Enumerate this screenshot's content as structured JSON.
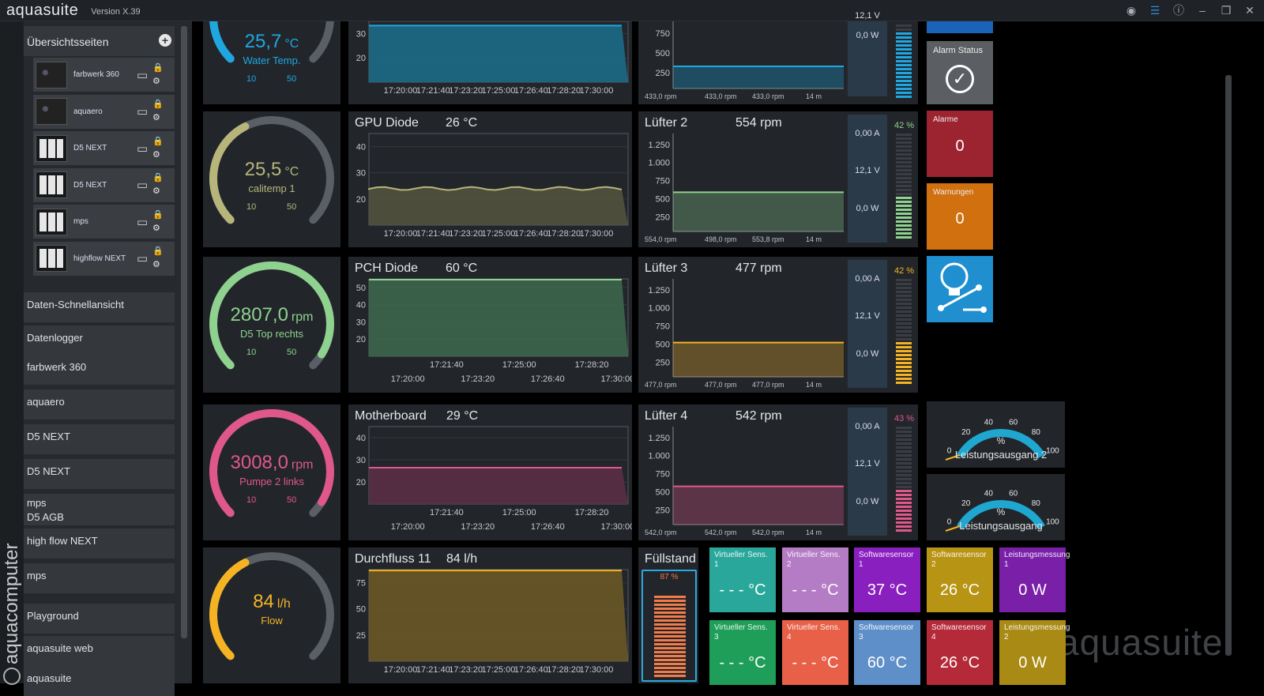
{
  "window": {
    "app_name": "aquasuite",
    "version": "Version X.39"
  },
  "sidebar": {
    "section_overview": "Übersichtsseiten",
    "overview_items": [
      {
        "label": "farbwerk 360",
        "thumb": "device"
      },
      {
        "label": "aquaero",
        "thumb": "device"
      },
      {
        "label": "D5 NEXT",
        "thumb": "grid"
      },
      {
        "label": "D5 NEXT",
        "thumb": "grid"
      },
      {
        "label": "mps",
        "thumb": "grid"
      },
      {
        "label": "highflow NEXT",
        "thumb": "grid"
      }
    ],
    "sections": [
      "Daten-Schnellansicht",
      "Datenlogger",
      "farbwerk 360",
      "aquaero",
      "D5 NEXT",
      "D5 NEXT",
      "mps",
      "D5 AGB",
      "high flow NEXT",
      "mps",
      "Playground",
      "aquasuite web",
      "aquasuite"
    ],
    "brand_vertical": "aquacomputer"
  },
  "gauges": [
    {
      "value": "25,7",
      "unit": "°C",
      "label": "Water Temp.",
      "min": "10",
      "max": "50",
      "color": "#1fa7e0",
      "fill": 0.42
    },
    {
      "value": "25,5",
      "unit": "°C",
      "label": "calitemp 1",
      "min": "10",
      "max": "50",
      "color": "#b7b57a",
      "fill": 0.4
    },
    {
      "value": "2807,0",
      "unit": "rpm",
      "label": "D5  Top rechts",
      "min": "10",
      "max": "50",
      "color": "#8fd18e",
      "fill": 0.95
    },
    {
      "value": "3008,0",
      "unit": "rpm",
      "label": "Pumpe 2 links",
      "min": "10",
      "max": "50",
      "color": "#e0578a",
      "fill": 0.95
    },
    {
      "value": "84",
      "unit": "l/h",
      "label": "Flow",
      "min": "",
      "max": "",
      "color": "#f5b324",
      "fill": 0.4
    }
  ],
  "charts": [
    {
      "title": "",
      "value": "",
      "color": "#1fa7e0",
      "fillcolor": "#1b6f8c",
      "yticks": [
        "30",
        "20"
      ],
      "xticks": [
        "17:20:00",
        "17:21:40",
        "17:23:20",
        "17:25:00",
        "17:26:40",
        "17:28:20",
        "17:30:00"
      ],
      "level": 0.93
    },
    {
      "title": "GPU Diode",
      "value": "26 °C",
      "color": "#b7b57a",
      "fillcolor": "#555540",
      "yticks": [
        "40",
        "30",
        "20"
      ],
      "xticks": [
        "17:20:00",
        "17:21:40",
        "17:23:20",
        "17:25:00",
        "17:26:40",
        "17:28:20",
        "17:30:00"
      ],
      "level": 0.4
    },
    {
      "title": "PCH Diode",
      "value": "60 °C",
      "color": "#8fd18e",
      "fillcolor": "#3e6a4e",
      "yticks": [
        "50",
        "40",
        "30",
        "20"
      ],
      "xticks": [
        "17:21:40",
        "17:25:00",
        "17:28:20"
      ],
      "xticks2": [
        "17:20:00",
        "17:23:20",
        "17:26:40",
        "17:30:00"
      ],
      "level": 0.99
    },
    {
      "title": "Motherboard",
      "value": "29 °C",
      "color": "#e0578a",
      "fillcolor": "#5e2f48",
      "yticks": [
        "40",
        "30",
        "20"
      ],
      "xticks": [
        "17:21:40",
        "17:25:00",
        "17:28:20"
      ],
      "xticks2": [
        "17:20:00",
        "17:23:20",
        "17:26:40",
        "17:30:00"
      ],
      "level": 0.47
    },
    {
      "title": "Durchfluss 11",
      "value": "84 l/h",
      "color": "#f5b324",
      "fillcolor": "#6e5a25",
      "yticks": [
        "75",
        "50",
        "25"
      ],
      "xticks": [
        "17:20:00",
        "17:21:40",
        "17:23:20",
        "17:25:00",
        "17:26:40",
        "17:28:20",
        "17:30:00"
      ],
      "level": 0.99
    }
  ],
  "fans": [
    {
      "title": "",
      "rpm": "",
      "current": "",
      "voltage": "12,1 V",
      "power": "0,0 W",
      "pct": "",
      "color": "#1fa7e0",
      "yticks": [
        "750",
        "500",
        "250"
      ],
      "foot": [
        "433,0 rpm",
        "433,0 rpm",
        "433,0 rpm",
        "14 m"
      ],
      "level": 0.33,
      "barfill": 0.92
    },
    {
      "title": "Lüfter 2",
      "rpm": "554 rpm",
      "current": "0,00 A",
      "voltage": "12,1 V",
      "power": "0,0 W",
      "pct": "42 %",
      "color": "#8fd18e",
      "yticks": [
        "1.250",
        "1.000",
        "750",
        "500",
        "250"
      ],
      "foot": [
        "554,0 rpm",
        "498,0 rpm",
        "553,8 rpm",
        "14 m"
      ],
      "level": 0.4,
      "barfill": 0.42
    },
    {
      "title": "Lüfter 3",
      "rpm": "477 rpm",
      "current": "0,00 A",
      "voltage": "12,1 V",
      "power": "0,0 W",
      "pct": "42 %",
      "color": "#f5b324",
      "yticks": [
        "1.250",
        "1.000",
        "750",
        "500",
        "250"
      ],
      "foot": [
        "477,0 rpm",
        "477,0 rpm",
        "477,0 rpm",
        "14 m"
      ],
      "level": 0.35,
      "barfill": 0.42
    },
    {
      "title": "Lüfter 4",
      "rpm": "542 rpm",
      "current": "0,00 A",
      "voltage": "12,1 V",
      "power": "0,0 W",
      "pct": "43 %",
      "color": "#e0578a",
      "yticks": [
        "1.250",
        "1.000",
        "750",
        "500",
        "250"
      ],
      "foot": [
        "542,0 rpm",
        "542,0 rpm",
        "542,0 rpm",
        "14 m"
      ],
      "level": 0.39,
      "barfill": 0.43
    }
  ],
  "level": {
    "title": "Füllstand",
    "pct": "87 %",
    "fill": 0.87
  },
  "status": {
    "alarm_status_label": "Alarm Status",
    "alarms_label": "Alarme",
    "alarms_value": "0",
    "warnings_label": "Warnungen",
    "warnings_value": "0"
  },
  "dials": [
    {
      "label": "Leistungsausgang 2",
      "unit": "%",
      "ticks": [
        "0",
        "20",
        "40",
        "60",
        "80",
        "100"
      ]
    },
    {
      "label": "Leistungsausgang",
      "unit": "%",
      "ticks": [
        "0",
        "20",
        "40",
        "60",
        "80",
        "100"
      ]
    }
  ],
  "tiles": [
    {
      "title": "Virtueller Sens. 1",
      "value": "- - - °C",
      "bg": "#2aa79b"
    },
    {
      "title": "Virtueller Sens. 2",
      "value": "- - - °C",
      "bg": "#b57cc6"
    },
    {
      "title": "Softwaresensor 1",
      "value": "37 °C",
      "bg": "#8a1fbf"
    },
    {
      "title": "Softwaresensor 2",
      "value": "26 °C",
      "bg": "#b89414"
    },
    {
      "title": "Leistungsmessung 1",
      "value": "0 W",
      "bg": "#7a1fa8"
    },
    {
      "title": "Virtueller Sens. 3",
      "value": "- - - °C",
      "bg": "#1e9e58"
    },
    {
      "title": "Virtueller Sens. 4",
      "value": "- - - °C",
      "bg": "#e86048"
    },
    {
      "title": "Softwaresensor 3",
      "value": "60 °C",
      "bg": "#5e8fc8"
    },
    {
      "title": "Softwaresensor 4",
      "value": "26 °C",
      "bg": "#b52a38"
    },
    {
      "title": "Leistungsmessung 2",
      "value": "0 W",
      "bg": "#a88a14"
    }
  ],
  "watermark": "aquasuite"
}
